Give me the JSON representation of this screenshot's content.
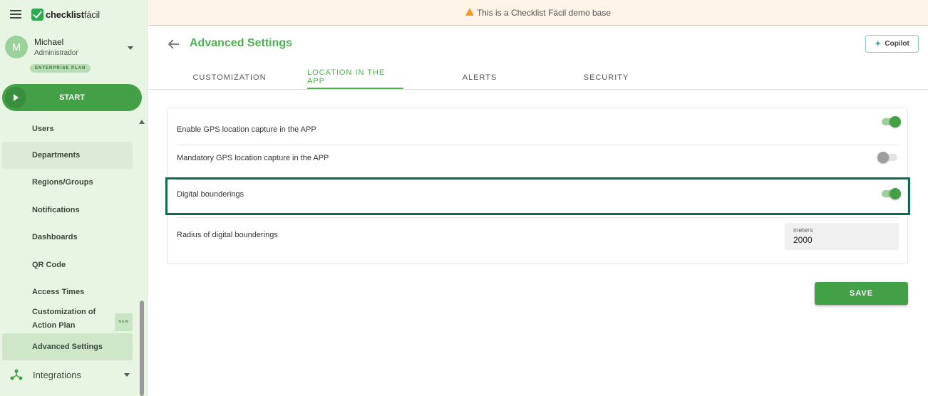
{
  "colors": {
    "accent": "#4caf50",
    "primary_button": "#43a047",
    "highlight": "#0e6b4c",
    "banner_bg": "#fdf3e6",
    "sidebar_bg": "#e8f5e3"
  },
  "sidebar": {
    "logo": {
      "bold": "checklist",
      "light": "fácil"
    },
    "user": {
      "initial": "M",
      "name": "Michael",
      "role": "Administrador"
    },
    "plan_badge": "ENTERPRISE PLAN",
    "start_label": "START",
    "items": [
      {
        "label": "Users"
      },
      {
        "label": "Departments"
      },
      {
        "label": "Regions/Groups"
      },
      {
        "label": "Notifications"
      },
      {
        "label": "Dashboards"
      },
      {
        "label": "QR Code"
      },
      {
        "label": "Access Times"
      },
      {
        "label_line1": "Customization of",
        "label_line2": "Action Plan",
        "badge": "NEW"
      },
      {
        "label": "Advanced Settings"
      }
    ],
    "integrations_label": "Integrations"
  },
  "banner": {
    "text": "This is a Checklist Fácil demo base",
    "icon": "warning-icon"
  },
  "header": {
    "title": "Advanced Settings",
    "copilot_label": "Copilot"
  },
  "tabs": [
    {
      "label": "CUSTOMIZATION"
    },
    {
      "label": "LOCATION IN THE APP",
      "active": true
    },
    {
      "label": "ALERTS"
    },
    {
      "label": "SECURITY"
    }
  ],
  "settings": {
    "gps_capture": {
      "label": "Enable GPS location capture in the APP",
      "enabled": true
    },
    "gps_mandatory": {
      "label": "Mandatory GPS location capture in the APP",
      "enabled": false
    },
    "digital_boundaries": {
      "label": "Digital bounderings",
      "enabled": true
    },
    "radius": {
      "label": "Radius of digital bounderings",
      "unit_label": "meters",
      "value": "2000"
    }
  },
  "save_label": "SAVE"
}
